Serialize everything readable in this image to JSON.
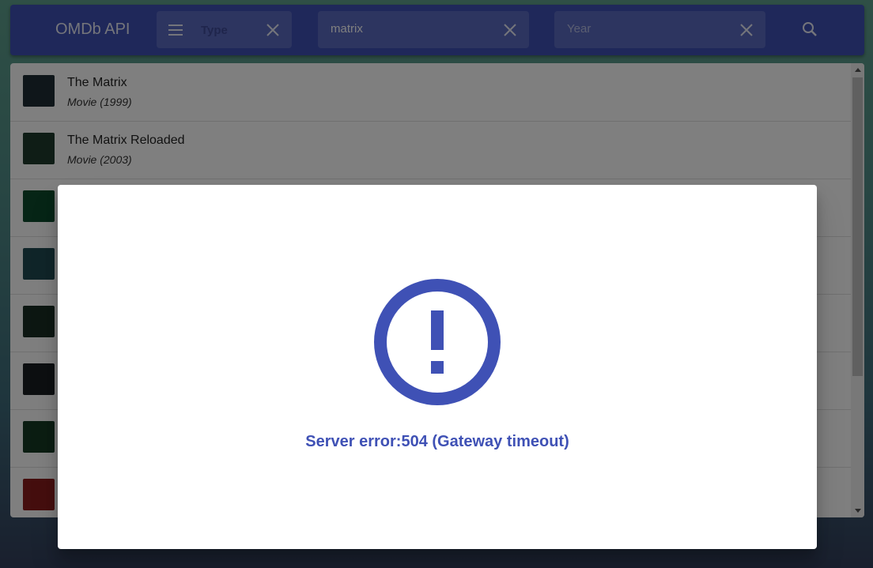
{
  "app": {
    "title": "OMDb API"
  },
  "toolbar": {
    "type_field": {
      "placeholder": "Type"
    },
    "search_field": {
      "value": "matrix"
    },
    "year_field": {
      "placeholder": "Year"
    }
  },
  "results": [
    {
      "title": "The Matrix",
      "subtitle": "Movie (1999)",
      "thumb_color": "#1f2c35"
    },
    {
      "title": "The Matrix Reloaded",
      "subtitle": "Movie (2003)",
      "thumb_color": "#1f3a2d"
    },
    {
      "title": "",
      "subtitle": "",
      "thumb_color": "#0d4a2c"
    },
    {
      "title": "",
      "subtitle": "",
      "thumb_color": "#214a52"
    },
    {
      "title": "",
      "subtitle": "",
      "thumb_color": "#1a2e24"
    },
    {
      "title": "",
      "subtitle": "",
      "thumb_color": "#1a1f22"
    },
    {
      "title": "",
      "subtitle": "",
      "thumb_color": "#163b25"
    },
    {
      "title": "",
      "subtitle": "",
      "thumb_color": "#8a1c1c"
    }
  ],
  "dialog": {
    "icon": "alert-circle-icon",
    "message": "Server error:504 (Gateway timeout)"
  },
  "colors": {
    "primary": "#3f51b5"
  }
}
